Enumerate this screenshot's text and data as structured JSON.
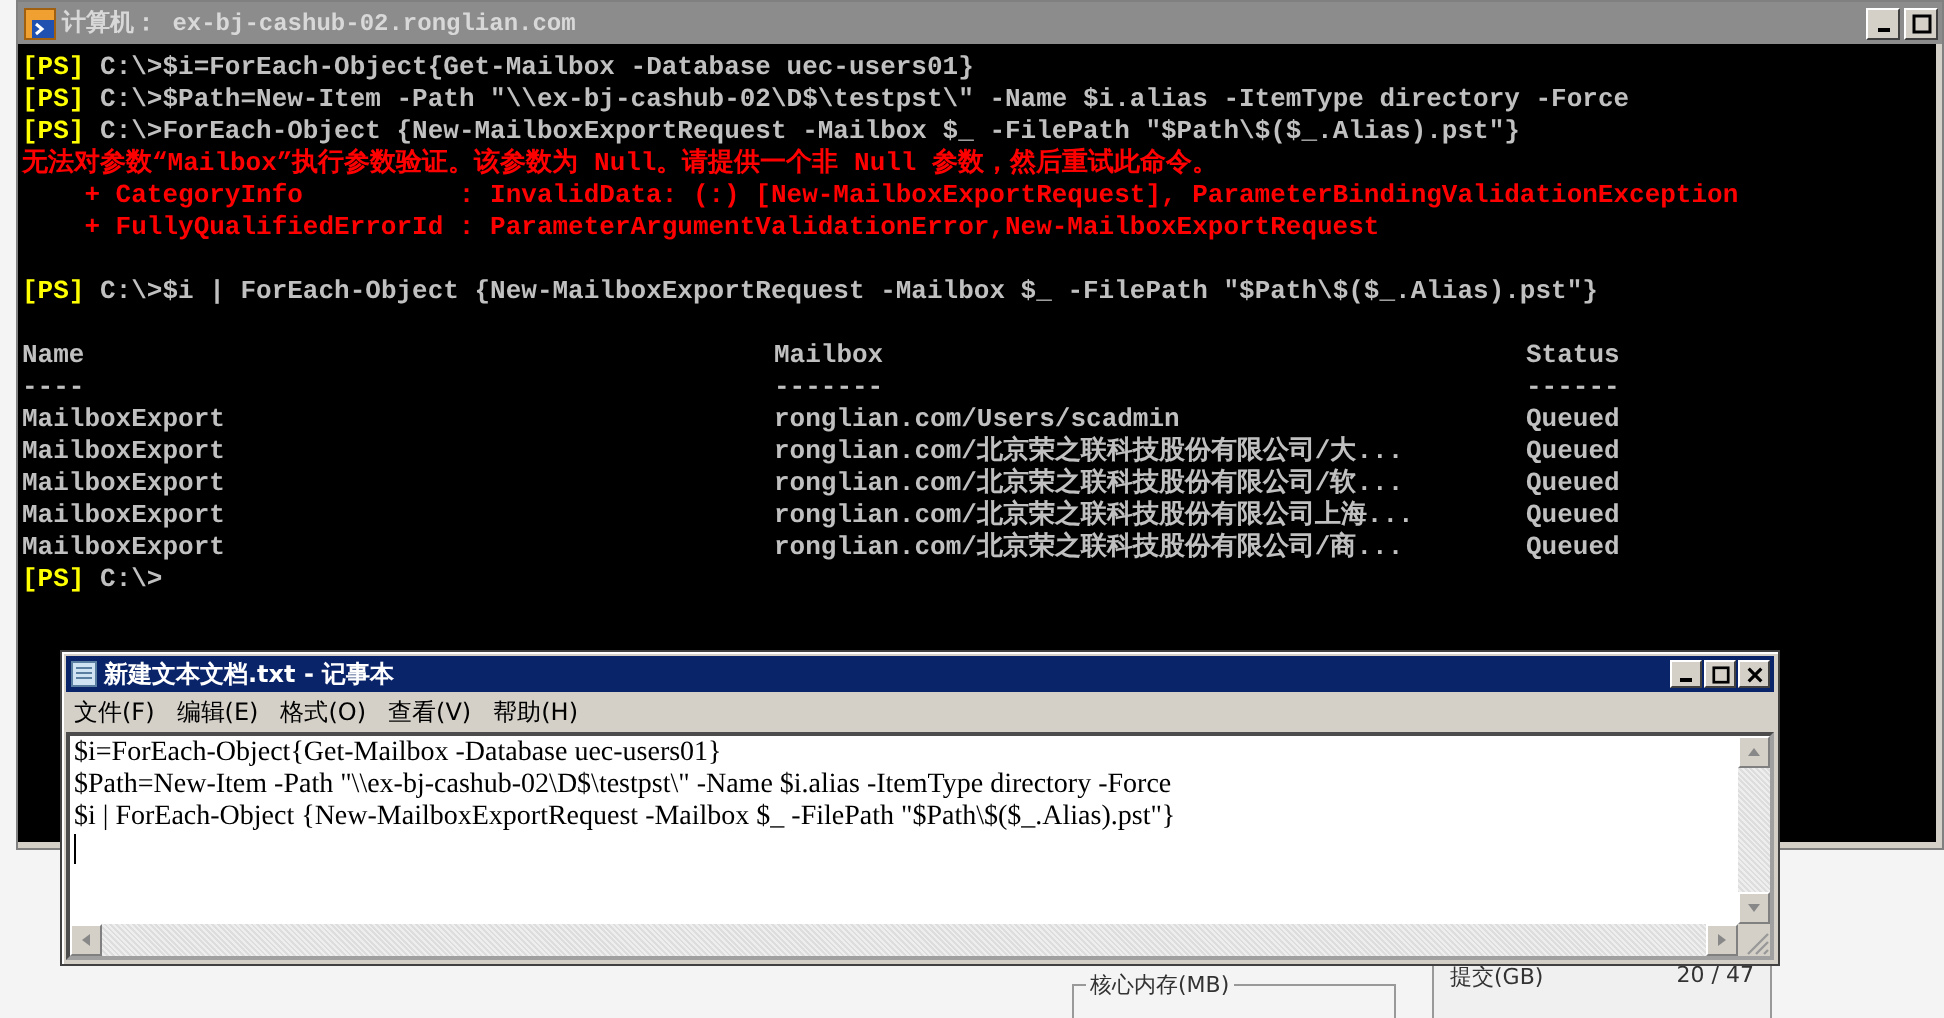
{
  "console": {
    "title": "计算机： ex-bj-cashub-02.ronglian.com",
    "lines": [
      {
        "kind": "prompt",
        "prompt": "[PS]",
        "text": "C:\\>$i=ForEach-Object{Get-Mailbox -Database uec-users01}"
      },
      {
        "kind": "prompt",
        "prompt": "[PS]",
        "text": "C:\\>$Path=New-Item -Path \"\\\\ex-bj-cashub-02\\D$\\testpst\\\" -Name $i.alias -ItemType directory -Force"
      },
      {
        "kind": "prompt",
        "prompt": "[PS]",
        "text": "C:\\>ForEach-Object {New-MailboxExportRequest -Mailbox $_ -FilePath \"$Path\\$($_.Alias).pst\"}"
      },
      {
        "kind": "error",
        "text": "无法对参数“Mailbox”执行参数验证。该参数为 Null。请提供一个非 Null 参数，然后重试此命令。"
      },
      {
        "kind": "error_detail",
        "text": "    + CategoryInfo          : InvalidData: (:) [New-MailboxExportRequest], ParameterBindingValidationException"
      },
      {
        "kind": "error_detail",
        "text": "    + FullyQualifiedErrorId : ParameterArgumentValidationError,New-MailboxExportRequest"
      },
      {
        "kind": "blank"
      },
      {
        "kind": "prompt",
        "prompt": "[PS]",
        "text": "C:\\>$i | ForEach-Object {New-MailboxExportRequest -Mailbox $_ -FilePath \"$Path\\$($_.Alias).pst\"}"
      },
      {
        "kind": "blank"
      }
    ],
    "table": {
      "columns": [
        "Name",
        "Mailbox",
        "Status"
      ],
      "underlines": [
        "----",
        "-------",
        "------"
      ],
      "rows": [
        [
          "MailboxExport",
          "ronglian.com/Users/scadmin",
          "Queued"
        ],
        [
          "MailboxExport",
          "ronglian.com/北京荣之联科技股份有限公司/大...",
          "Queued"
        ],
        [
          "MailboxExport",
          "ronglian.com/北京荣之联科技股份有限公司/软...",
          "Queued"
        ],
        [
          "MailboxExport",
          "ronglian.com/北京荣之联科技股份有限公司上海...",
          "Queued"
        ],
        [
          "MailboxExport",
          "ronglian.com/北京荣之联科技股份有限公司/商...",
          "Queued"
        ]
      ]
    },
    "final_prompt": {
      "prompt": "[PS]",
      "text": "C:\\>"
    }
  },
  "notepad": {
    "title": "新建文本文档.txt - 记事本",
    "menu": [
      "文件(F)",
      "编辑(E)",
      "格式(O)",
      "查看(V)",
      "帮助(H)"
    ],
    "lines": [
      "$i=ForEach-Object{Get-Mailbox -Database uec-users01}",
      "$Path=New-Item -Path \"\\\\ex-bj-cashub-02\\D$\\testpst\\\" -Name $i.alias -ItemType directory -Force",
      "$i | ForEach-Object {New-MailboxExportRequest -Mailbox $_ -FilePath \"$Path\\$($_.Alias).pst\"}"
    ]
  },
  "background": {
    "commit_label": "提交(GB)",
    "commit_value": "20 / 47",
    "kernel_memory_label": "核心内存(MB)"
  }
}
